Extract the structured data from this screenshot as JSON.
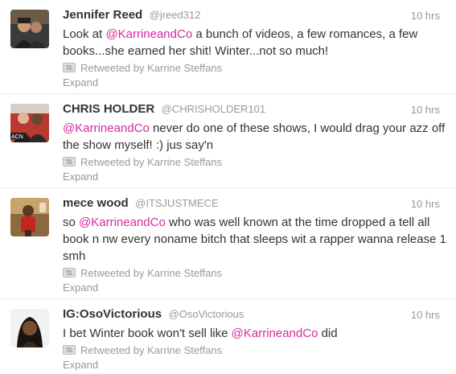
{
  "tweets": [
    {
      "name": "Jennifer Reed",
      "handle": "@jreed312",
      "time": "10 hrs",
      "text_before": "Look at ",
      "mention": "@KarrineandCo",
      "text_after": " a bunch of videos, a few romances, a few books...she earned her shit! Winter...not so much!",
      "retweeted_by": "Retweeted by Karrine Steffans",
      "expand": "Expand"
    },
    {
      "name": "CHRIS HOLDER",
      "handle": "@CHRISHOLDER101",
      "time": "10 hrs",
      "text_before": "",
      "mention": "@KarrineandCo",
      "text_after": " never do one of these shows, I would drag your azz off the show myself! :) jus say'n",
      "retweeted_by": "Retweeted by Karrine Steffans",
      "expand": "Expand"
    },
    {
      "name": "mece wood",
      "handle": "@ITSJUSTMECE",
      "time": "10 hrs",
      "text_before": "so ",
      "mention": "@KarrineandCo",
      "text_after": " who was well known at the time dropped a tell all book n nw every noname bitch that sleeps wit a rapper wanna release 1 smh",
      "retweeted_by": "Retweeted by Karrine Steffans",
      "expand": "Expand"
    },
    {
      "name": "IG:OsoVictorious",
      "handle": "@OsoVictorious",
      "time": "10 hrs",
      "text_before": "I bet Winter book won't sell like ",
      "mention": "@KarrineandCo",
      "text_after": " did",
      "retweeted_by": "Retweeted by Karrine Steffans",
      "expand": "Expand"
    }
  ]
}
